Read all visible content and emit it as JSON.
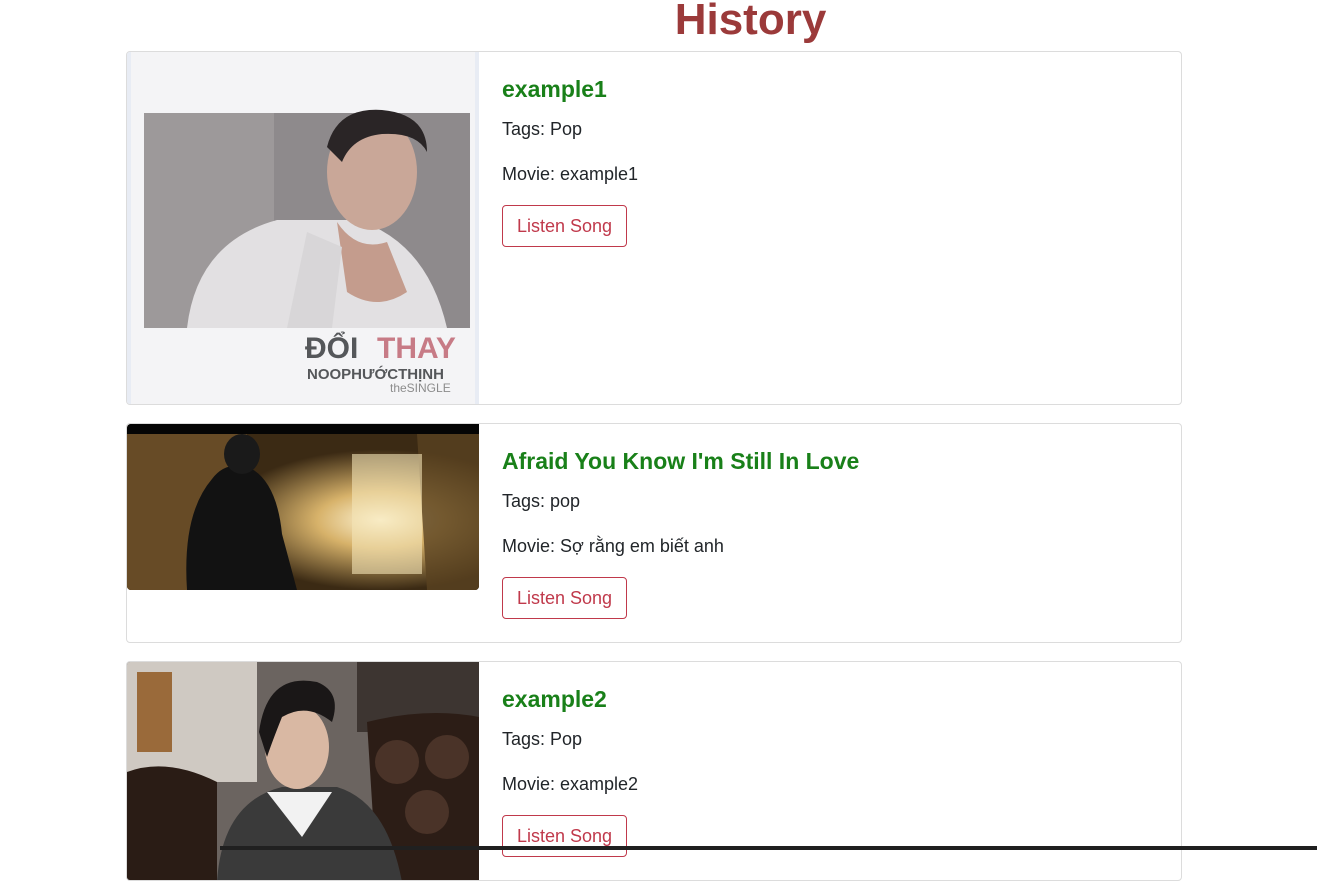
{
  "page": {
    "title": "History"
  },
  "songs": [
    {
      "title": "example1",
      "tags_label": "Tags: Pop",
      "movie_label": "Movie: example1",
      "button_label": "Listen Song",
      "cover": {
        "text_line1": "ĐỔI",
        "text_line1b": "THAY",
        "text_line2": "NOOPHƯỚCTHỊNH",
        "text_line3": "theSINGLE"
      }
    },
    {
      "title": "Afraid You Know I'm Still In Love",
      "tags_label": "Tags: pop",
      "movie_label": "Movie: Sợ rằng em biết anh",
      "button_label": "Listen Song"
    },
    {
      "title": "example2",
      "tags_label": "Tags: Pop",
      "movie_label": "Movie: example2",
      "button_label": "Listen Song"
    }
  ],
  "colors": {
    "title": "#9b3a3a",
    "song_title": "#198019",
    "button": "#c0394b"
  }
}
